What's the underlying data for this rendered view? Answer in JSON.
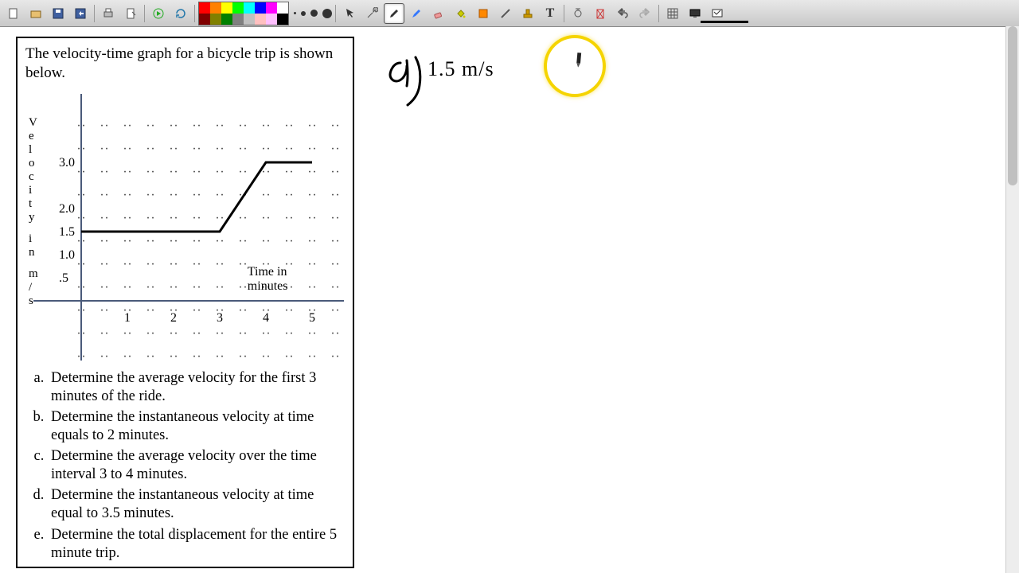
{
  "toolbar": {
    "swatches": [
      "#ff0000",
      "#ff8000",
      "#ffff00",
      "#00ff00",
      "#00ffff",
      "#0000ff",
      "#ff00ff",
      "#ffffff",
      "#800000",
      "#808000",
      "#008000",
      "#808080",
      "#c0c0c0",
      "#ffc0c0",
      "#ffc0ff",
      "#000000"
    ],
    "selected_swatch": 15
  },
  "problem": {
    "title": "The velocity-time graph for a bicycle trip is shown below.",
    "questions": [
      "Determine the average velocity for the first 3 minutes of the ride.",
      "Determine the instantaneous velocity at time equals to 2 minutes.",
      "Determine the average velocity over the time interval 3 to 4 minutes.",
      "Determine the instantaneous velocity at time equal to 3.5 minutes.",
      "Determine the total displacement for the entire 5 minute trip."
    ]
  },
  "chart_data": {
    "type": "line",
    "title": "",
    "xlabel": "Time in minutes",
    "ylabel": "Velocity in m/s",
    "x_ticks": [
      1,
      2,
      3,
      4,
      5
    ],
    "y_ticks": [
      0.5,
      1.0,
      1.5,
      2.0,
      3.0
    ],
    "y_tick_labels": [
      ".5",
      "1.0",
      "1.5",
      "2.0",
      "3.0"
    ],
    "xlim": [
      0,
      5.5
    ],
    "ylim": [
      -1.5,
      4
    ],
    "series": [
      {
        "name": "velocity",
        "x": [
          0,
          3,
          4,
          5
        ],
        "y": [
          1.5,
          1.5,
          3.0,
          3.0
        ]
      }
    ]
  },
  "handwriting": {
    "label_a": "a)",
    "answer_a": "1.5 m/s"
  }
}
